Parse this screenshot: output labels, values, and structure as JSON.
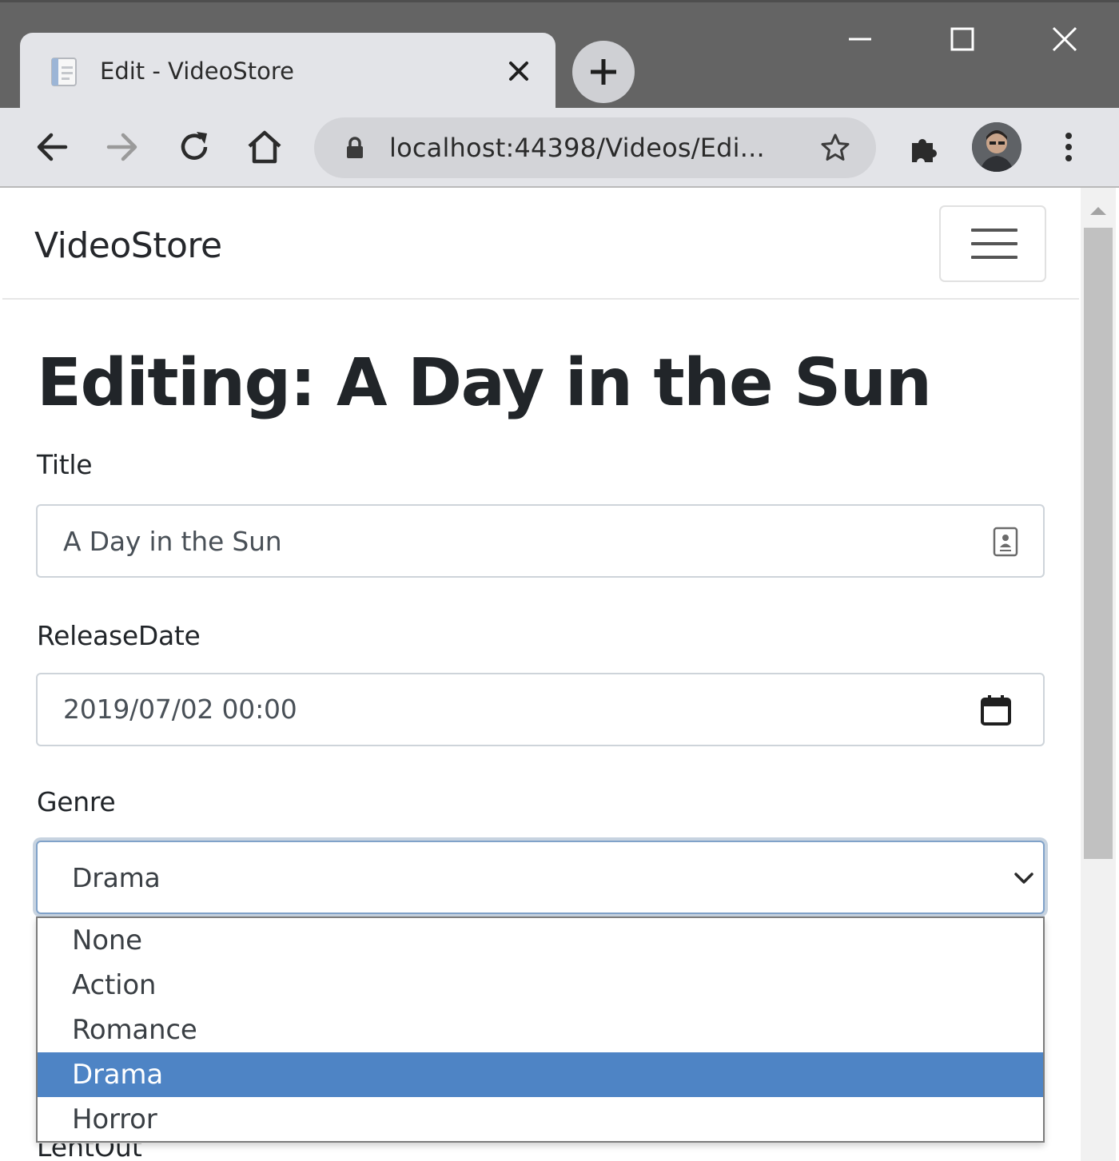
{
  "browser": {
    "tab_title": "Edit - VideoStore",
    "url": "localhost:44398/Videos/Edi...",
    "icons": [
      "back-icon",
      "forward-icon",
      "reload-icon",
      "home-icon",
      "lock-icon",
      "star-icon",
      "extensions-icon",
      "profile-avatar",
      "menu-icon",
      "minimize-icon",
      "maximize-icon",
      "close-icon",
      "new-tab-icon"
    ]
  },
  "navbar": {
    "brand": "VideoStore"
  },
  "page": {
    "title": "Editing: A Day in the Sun"
  },
  "form": {
    "title_label": "Title",
    "title_value": "A Day in the Sun",
    "release_label": "ReleaseDate",
    "release_value": "2019/07/02  00:00",
    "genre_label": "Genre",
    "genre_value": "Drama",
    "genre_options": [
      "None",
      "Action",
      "Romance",
      "Drama",
      "Horror"
    ],
    "genre_selected_index": 3,
    "next_label_partial": "LentOut"
  },
  "colors": {
    "selected_option": "#4e84c5",
    "titlebar": "#646464",
    "toolbar": "#e3e4e8"
  }
}
